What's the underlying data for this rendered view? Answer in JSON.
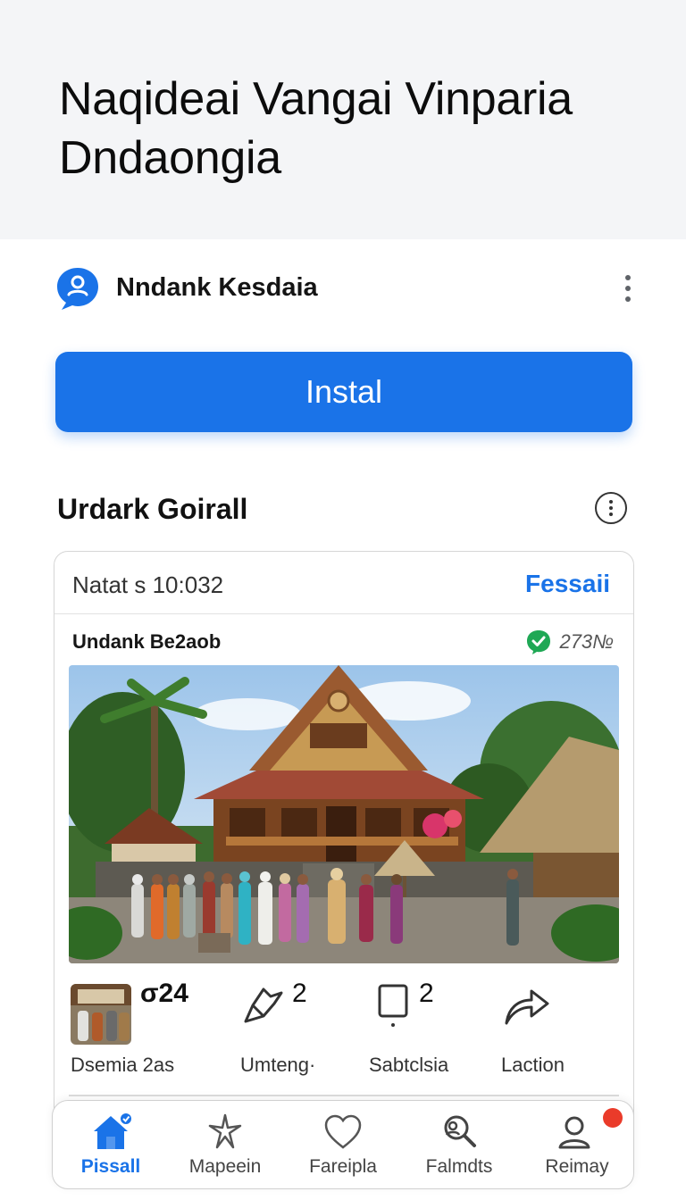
{
  "header": {
    "title": "Naqideai Vangai Vinparia Dndaongia"
  },
  "app": {
    "name": "Nndank Kesdaia",
    "icon": "chat-user-icon",
    "install_label": "Instal",
    "accent_color": "#1a73e8"
  },
  "section": {
    "title": "Urdark Goirall"
  },
  "card": {
    "status": "Natat s 10:032",
    "link_label": "Fessaii",
    "user": "Undank Be2aob",
    "count": "273№",
    "count_icon": "green-check-badge-icon"
  },
  "stats": [
    {
      "icon": "thumbnail",
      "value": "σ24",
      "label": "Dsemia 2as"
    },
    {
      "icon": "pointer-arrow-icon",
      "value": "2",
      "label": "Umteng·"
    },
    {
      "icon": "comment-square-icon",
      "value": "2",
      "label": "Sabtclsia"
    },
    {
      "icon": "share-arrow-icon",
      "value": "",
      "label": "Laction"
    }
  ],
  "nav": [
    {
      "icon": "home-icon",
      "label": "Pissall",
      "active": true
    },
    {
      "icon": "star-sparkle-icon",
      "label": "Mapeein",
      "active": false
    },
    {
      "icon": "heart-icon",
      "label": "Fareipla",
      "active": false
    },
    {
      "icon": "search-people-icon",
      "label": "Falmdts",
      "active": false
    },
    {
      "icon": "profile-icon",
      "label": "Reimay",
      "active": false,
      "badge": true
    }
  ]
}
